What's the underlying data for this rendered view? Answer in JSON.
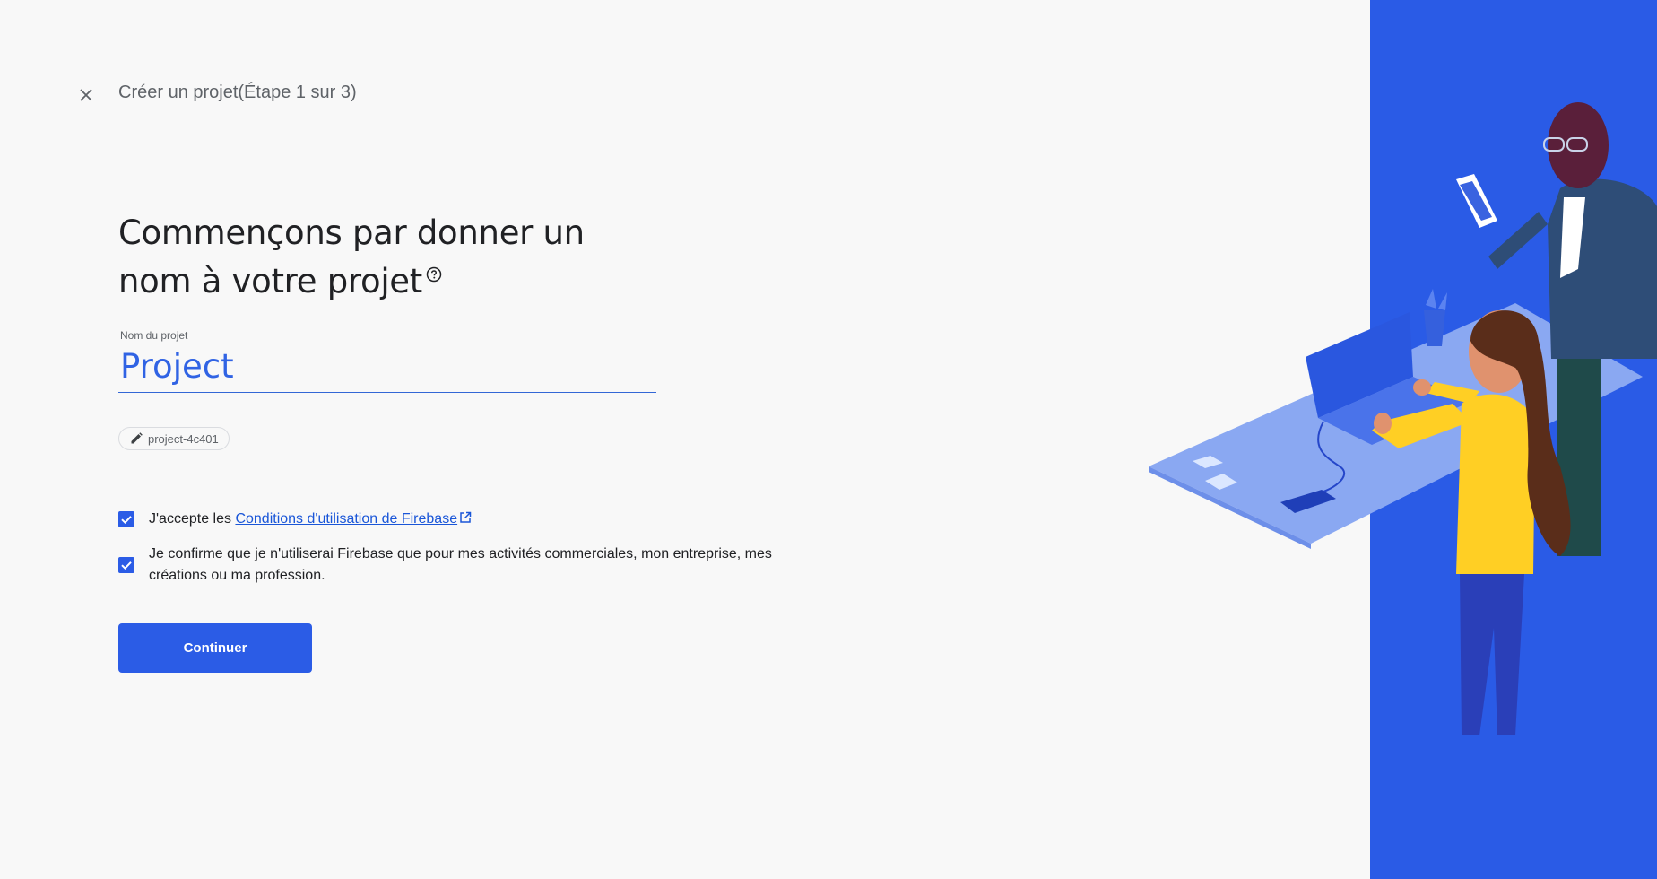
{
  "header": {
    "step_title": "Créer un projet(Étape 1 sur 3)",
    "close_icon": "close-icon"
  },
  "headline": {
    "line1": "Commençons par donner un",
    "line2": "nom à votre projet",
    "help_icon": "help-circle-icon"
  },
  "project_name": {
    "label": "Nom du projet",
    "value": "Project"
  },
  "project_id_chip": {
    "icon": "pencil-icon",
    "text": "project-4c401"
  },
  "consent": {
    "terms_prefix": "J'accepte les",
    "terms_link": "Conditions d'utilisation de Firebase",
    "terms_checked": true,
    "business_text": "Je confirme que je n'utiliserai Firebase que pour mes activités commerciales, mon entreprise, mes créations ou ma profession.",
    "business_checked": true
  },
  "actions": {
    "continue_label": "Continuer"
  },
  "colors": {
    "accent": "#2b5ce6",
    "panel": "#2a5be6",
    "input_text": "#3063e4"
  }
}
